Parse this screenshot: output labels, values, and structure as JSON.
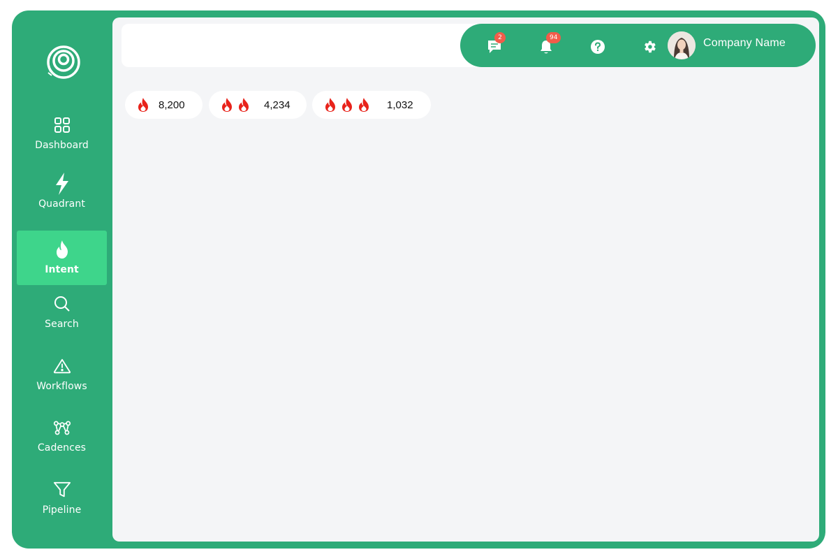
{
  "sidebar": {
    "logo_icon": "spiral-logo-icon",
    "items": [
      {
        "label": "Dashboard",
        "icon": "grid-icon",
        "active": false
      },
      {
        "label": "Quadrant",
        "icon": "lightning-icon",
        "active": false
      },
      {
        "label": "Intent",
        "icon": "flame-icon",
        "active": true
      },
      {
        "label": "Search",
        "icon": "search-icon",
        "active": false
      },
      {
        "label": "Workflows",
        "icon": "warning-triangle-icon",
        "active": false
      },
      {
        "label": "Cadences",
        "icon": "nodes-icon",
        "active": false
      },
      {
        "label": "Pipeline",
        "icon": "funnel-icon",
        "active": false
      }
    ]
  },
  "topbar": {
    "messages_badge": "2",
    "notifications_badge": "94",
    "company_name": "Company Name"
  },
  "intent_levels": [
    {
      "flames": 1,
      "count": "8,200"
    },
    {
      "flames": 2,
      "count": "4,234"
    },
    {
      "flames": 3,
      "count": "1,032"
    }
  ],
  "colors": {
    "brand_green": "#2eab78",
    "active_green": "#3ed58b",
    "badge_red": "#f25c4a",
    "flame_red": "#e8231b"
  }
}
